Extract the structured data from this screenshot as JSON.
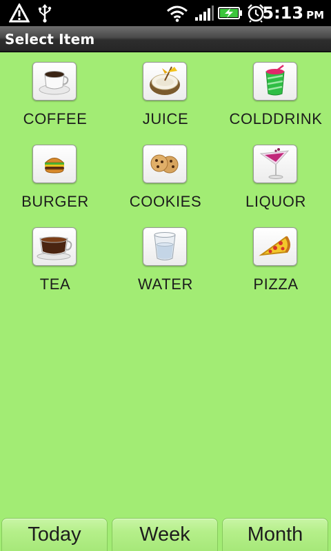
{
  "status_bar": {
    "icons": [
      "alert-icon",
      "usb-icon",
      "wifi-icon",
      "signal-icon",
      "battery-charging-icon",
      "alarm-icon"
    ],
    "time": "5:13",
    "ampm": "PM"
  },
  "header": {
    "title": "Select Item"
  },
  "items": [
    {
      "label": "COFFEE",
      "icon": "coffee-icon"
    },
    {
      "label": "JUICE",
      "icon": "juice-icon"
    },
    {
      "label": "COLDDRINK",
      "icon": "colddrink-icon"
    },
    {
      "label": "BURGER",
      "icon": "burger-icon"
    },
    {
      "label": "COOKIES",
      "icon": "cookies-icon"
    },
    {
      "label": "LIQUOR",
      "icon": "liquor-icon"
    },
    {
      "label": "TEA",
      "icon": "tea-icon"
    },
    {
      "label": "WATER",
      "icon": "water-icon"
    },
    {
      "label": "PIZZA",
      "icon": "pizza-icon"
    }
  ],
  "tabs": [
    {
      "label": "Today"
    },
    {
      "label": "Week"
    },
    {
      "label": "Month"
    }
  ],
  "colors": {
    "background": "#a2ec74",
    "tab": "#b5ef8a",
    "title_bar": "#3a3a3a"
  }
}
